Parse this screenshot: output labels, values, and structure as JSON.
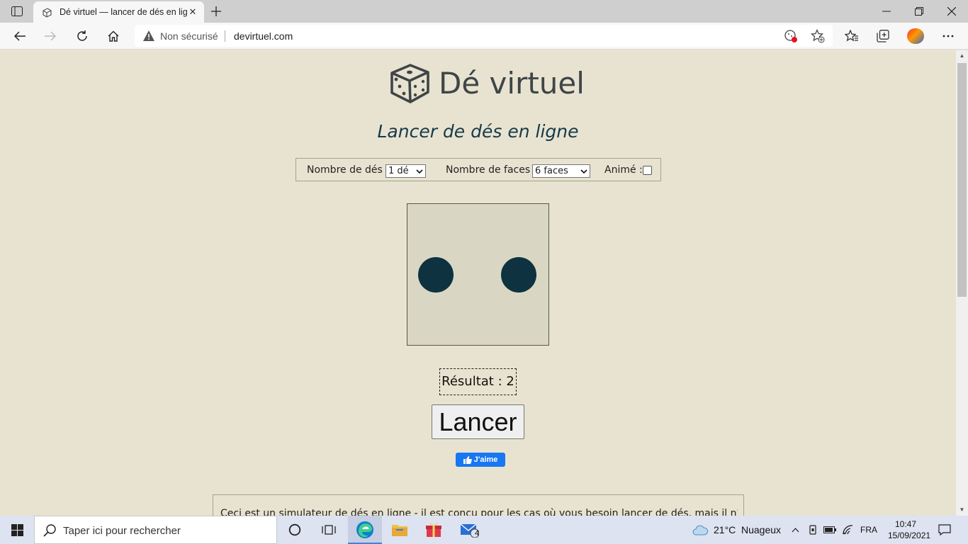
{
  "browser": {
    "tab_title": "Dé virtuel — lancer de dés en ligne",
    "tab_close": "✕",
    "security_label": "Non sécurisé",
    "url": "devirtuel.com"
  },
  "site": {
    "logo_text": "Dé virtuel",
    "subtitle": "Lancer de dés en ligne",
    "options": {
      "dice_count_label": "Nombre de dés :",
      "dice_count_value": "1 dé",
      "faces_label": "Nombre de faces :",
      "faces_value": "6 faces",
      "animated_label": "Animé :",
      "animated_checked": false
    },
    "die_face_value": 2,
    "result_text": "Résultat : 2",
    "roll_button": "Lancer",
    "fb_like": "J'aime",
    "description": "Ceci est un simulateur de dés en ligne - il est conçu pour les cas où vous besoin lancer de dés, mais il n'y en a"
  },
  "taskbar": {
    "search_placeholder": "Taper ici pour rechercher",
    "mail_badge": "4",
    "weather_temp": "21°C",
    "weather_desc": "Nuageux",
    "language": "FRA",
    "time": "10:47",
    "date": "15/09/2021"
  },
  "colors": {
    "page_bg": "#e8e3d0",
    "die_bg": "#d9d7c4",
    "pip": "#0e3240",
    "subtitle": "#153a4a",
    "fb_blue": "#1877f2"
  }
}
